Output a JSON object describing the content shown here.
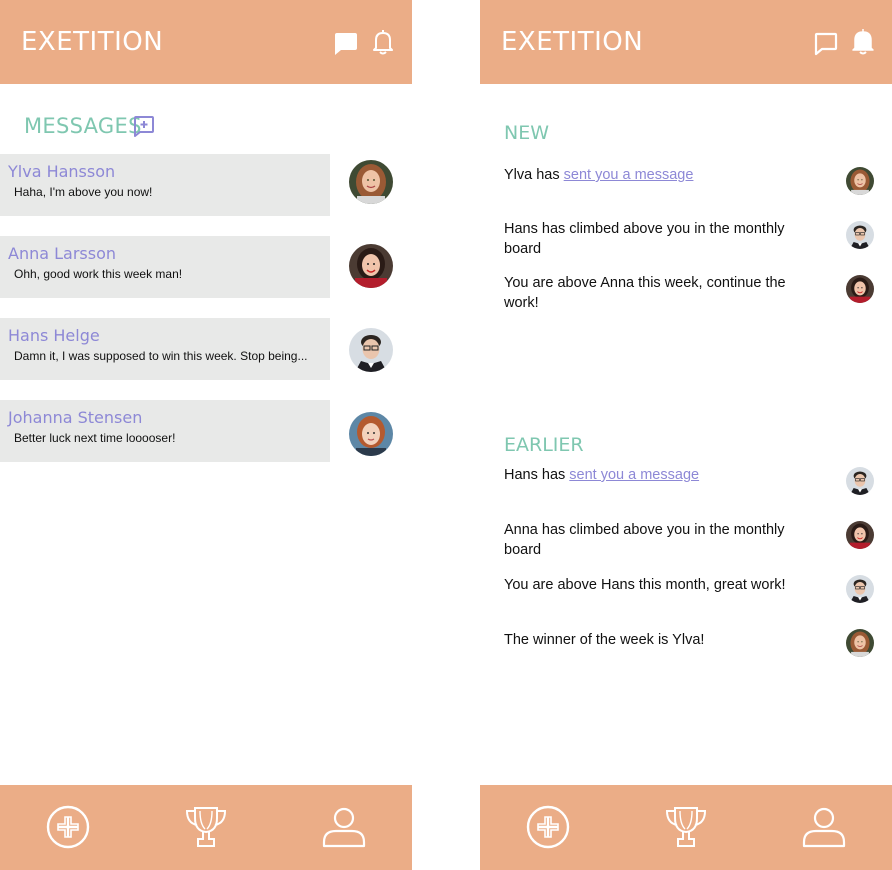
{
  "app": {
    "title": "EXETITION"
  },
  "colors": {
    "header": "#ebad87",
    "accent_green": "#7fc7b0",
    "accent_purple": "#8d88d6",
    "card": "#e8e9e8"
  },
  "icons": {
    "chat": "chat-bubble-icon",
    "bell": "bell-icon",
    "new_message": "new-message-icon",
    "nav_add": "add-circle-icon",
    "nav_trophy": "trophy-icon",
    "nav_profile": "user-icon"
  },
  "messages": {
    "title": "MESSAGES",
    "items": [
      {
        "name": "Ylva Hansson",
        "preview": "Haha, I'm above you now!"
      },
      {
        "name": "Anna Larsson",
        "preview": "Ohh, good work this week man!"
      },
      {
        "name": "Hans Helge",
        "preview": "Damn it, I was supposed to win this week. Stop being..."
      },
      {
        "name": "Johanna Stensen",
        "preview": "Better luck next time looooser!"
      }
    ]
  },
  "notifications": {
    "new_title": "NEW",
    "earlier_title": "EARLIER",
    "new": [
      {
        "prefix": "Ylva has ",
        "link": "sent you a message"
      },
      {
        "text": "Hans has climbed above you in the monthly board"
      },
      {
        "text": "You are above Anna this week, continue the work!"
      }
    ],
    "earlier": [
      {
        "prefix": "Hans has ",
        "link": "sent you a message"
      },
      {
        "text": "Anna has climbed above you in the monthly board"
      },
      {
        "text": "You are above Hans this month, great work!"
      },
      {
        "text": "The winner of the week is Ylva!"
      }
    ]
  }
}
